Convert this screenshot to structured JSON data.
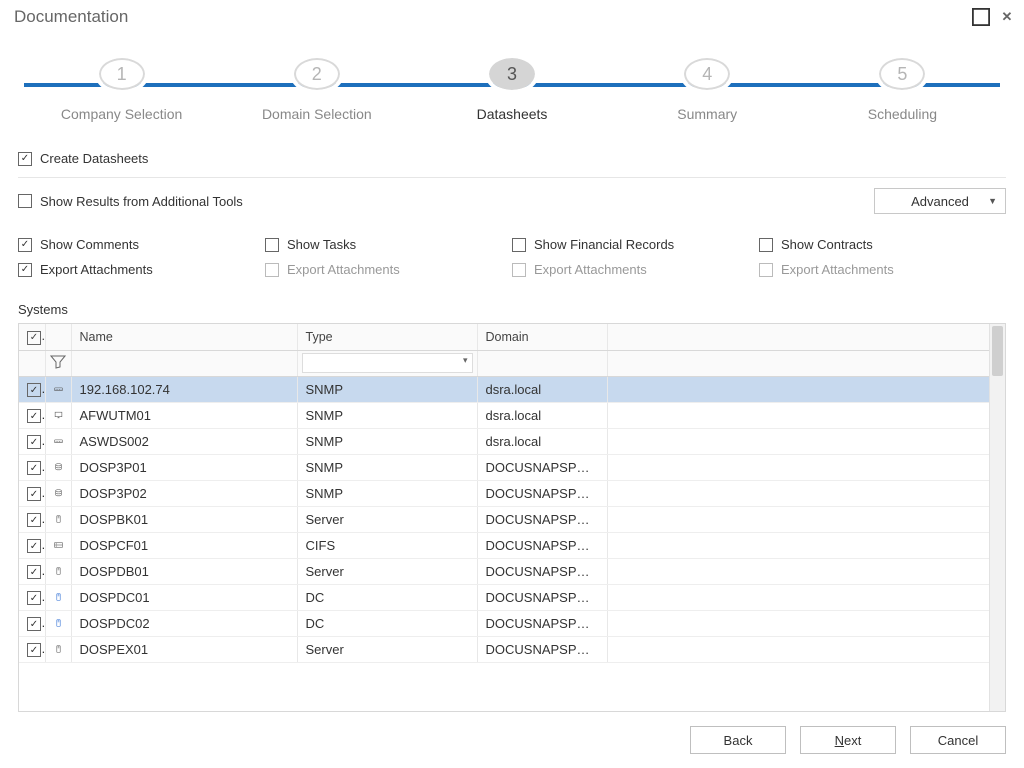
{
  "window": {
    "title": "Documentation"
  },
  "stepper": {
    "active": 3,
    "steps": [
      {
        "num": "1",
        "label": "Company Selection"
      },
      {
        "num": "2",
        "label": "Domain Selection"
      },
      {
        "num": "3",
        "label": "Datasheets"
      },
      {
        "num": "4",
        "label": "Summary"
      },
      {
        "num": "5",
        "label": "Scheduling"
      }
    ]
  },
  "options": {
    "create_datasheets": {
      "label": "Create Datasheets",
      "checked": true
    },
    "additional_tools": {
      "label": "Show Results from Additional Tools",
      "checked": false
    },
    "advanced_label": "Advanced",
    "row1": [
      {
        "label": "Show Comments",
        "checked": true,
        "enabled": true
      },
      {
        "label": "Show Tasks",
        "checked": false,
        "enabled": true
      },
      {
        "label": "Show Financial Records",
        "checked": false,
        "enabled": true
      },
      {
        "label": "Show Contracts",
        "checked": false,
        "enabled": true
      }
    ],
    "row2": [
      {
        "label": "Export Attachments",
        "checked": true,
        "enabled": true
      },
      {
        "label": "Export Attachments",
        "checked": false,
        "enabled": false
      },
      {
        "label": "Export Attachments",
        "checked": false,
        "enabled": false
      },
      {
        "label": "Export Attachments",
        "checked": false,
        "enabled": false
      }
    ]
  },
  "table": {
    "section_label": "Systems",
    "headers": {
      "name": "Name",
      "type": "Type",
      "domain": "Domain"
    },
    "rows": [
      {
        "checked": true,
        "icon": "switch",
        "name": "192.168.102.74",
        "type": "SNMP",
        "domain": "dsra.local",
        "selected": true
      },
      {
        "checked": true,
        "icon": "monitor",
        "name": "AFWUTM01",
        "type": "SNMP",
        "domain": "dsra.local"
      },
      {
        "checked": true,
        "icon": "switch",
        "name": "ASWDS002",
        "type": "SNMP",
        "domain": "dsra.local"
      },
      {
        "checked": true,
        "icon": "db",
        "name": "DOSP3P01",
        "type": "SNMP",
        "domain": "DOCUSNAPSPOR..."
      },
      {
        "checked": true,
        "icon": "db",
        "name": "DOSP3P02",
        "type": "SNMP",
        "domain": "DOCUSNAPSPOR..."
      },
      {
        "checked": true,
        "icon": "server",
        "name": "DOSPBK01",
        "type": "Server",
        "domain": "DOCUSNAPSPOR..."
      },
      {
        "checked": true,
        "icon": "nas",
        "name": "DOSPCF01",
        "type": "CIFS",
        "domain": "DOCUSNAPSPOR..."
      },
      {
        "checked": true,
        "icon": "server",
        "name": "DOSPDB01",
        "type": "Server",
        "domain": "DOCUSNAPSPOR..."
      },
      {
        "checked": true,
        "icon": "dc",
        "name": "DOSPDC01",
        "type": "DC",
        "domain": "DOCUSNAPSPOR..."
      },
      {
        "checked": true,
        "icon": "dc",
        "name": "DOSPDC02",
        "type": "DC",
        "domain": "DOCUSNAPSPOR..."
      },
      {
        "checked": true,
        "icon": "server",
        "name": "DOSPEX01",
        "type": "Server",
        "domain": "DOCUSNAPSPOR..."
      }
    ]
  },
  "footer": {
    "back": "Back",
    "next_pre": "N",
    "next_post": "ext",
    "cancel": "Cancel"
  }
}
